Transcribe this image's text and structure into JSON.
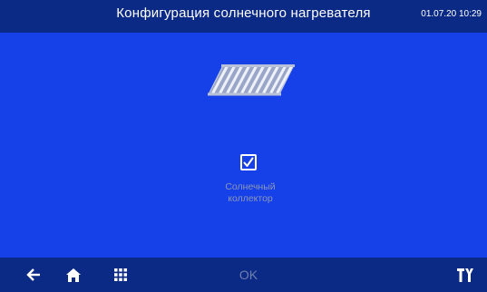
{
  "header": {
    "title": "Конфигурация солнечного нагревателя",
    "datetime": "01.07.20 10:29"
  },
  "main": {
    "collector_icon": "solar-collector-icon",
    "checkbox": {
      "checked": true,
      "label_line1": "Солнечный",
      "label_line2": "коллектор"
    }
  },
  "footer": {
    "back_icon": "arrow-left-icon",
    "home_icon": "home-icon",
    "menu_icon": "grid-icon",
    "ok_label": "OK",
    "tools_icon": "tools-icon"
  },
  "colors": {
    "header_bg": "#0b2a86",
    "main_bg": "#1640e8",
    "text_white": "#ffffff",
    "label_dim": "#8c97b8",
    "ok_dim": "#6f7fae"
  }
}
